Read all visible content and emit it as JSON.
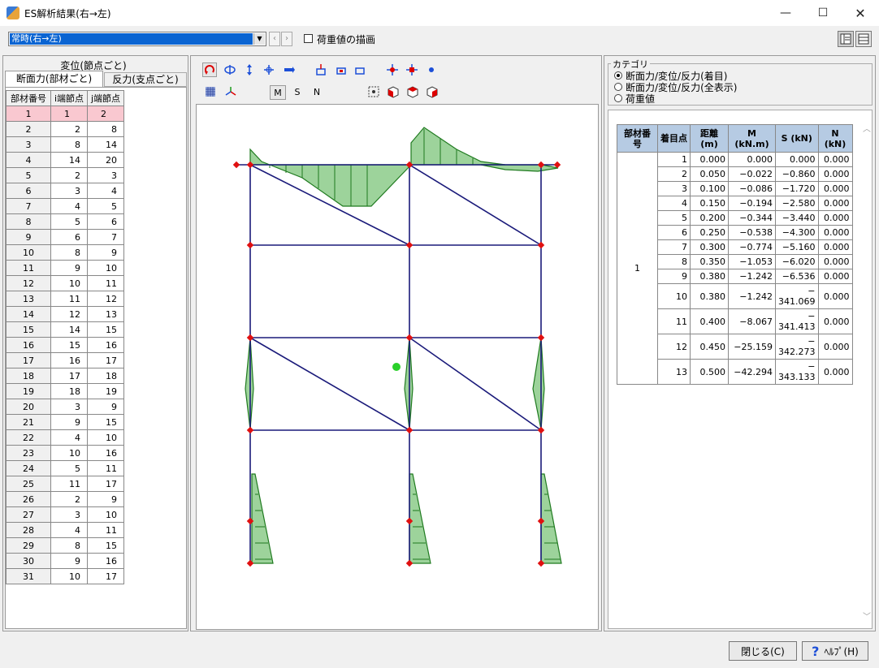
{
  "window": {
    "title": "ES解析結果(右→左)",
    "controls": {
      "minimize": "—",
      "maximize": "☐",
      "close": "✕"
    }
  },
  "toolbar": {
    "case_value": "常時(右→左)",
    "prev": "‹",
    "next": "›",
    "load_checkbox_label": "荷重値の描画",
    "load_checkbox_checked": false
  },
  "left": {
    "tab_top": "変位(節点ごと)",
    "tab_forces": "断面力(部材ごと)",
    "tab_reactions": "反力(支点ごと)",
    "table": {
      "headers": [
        "部材番号",
        "i端節点",
        "j端節点"
      ],
      "selected_index": 0,
      "rows": [
        [
          "1",
          "1",
          "2"
        ],
        [
          "2",
          "2",
          "8"
        ],
        [
          "3",
          "8",
          "14"
        ],
        [
          "4",
          "14",
          "20"
        ],
        [
          "5",
          "2",
          "3"
        ],
        [
          "6",
          "3",
          "4"
        ],
        [
          "7",
          "4",
          "5"
        ],
        [
          "8",
          "5",
          "6"
        ],
        [
          "9",
          "6",
          "7"
        ],
        [
          "10",
          "8",
          "9"
        ],
        [
          "11",
          "9",
          "10"
        ],
        [
          "12",
          "10",
          "11"
        ],
        [
          "13",
          "11",
          "12"
        ],
        [
          "14",
          "12",
          "13"
        ],
        [
          "15",
          "14",
          "15"
        ],
        [
          "16",
          "15",
          "16"
        ],
        [
          "17",
          "16",
          "17"
        ],
        [
          "18",
          "17",
          "18"
        ],
        [
          "19",
          "18",
          "19"
        ],
        [
          "20",
          "3",
          "9"
        ],
        [
          "21",
          "9",
          "15"
        ],
        [
          "22",
          "4",
          "10"
        ],
        [
          "23",
          "10",
          "16"
        ],
        [
          "24",
          "5",
          "11"
        ],
        [
          "25",
          "11",
          "17"
        ],
        [
          "26",
          "2",
          "9"
        ],
        [
          "27",
          "3",
          "10"
        ],
        [
          "28",
          "4",
          "11"
        ],
        [
          "29",
          "8",
          "15"
        ],
        [
          "30",
          "9",
          "16"
        ],
        [
          "31",
          "10",
          "17"
        ]
      ]
    }
  },
  "center": {
    "mode_m": "M",
    "mode_s": "S",
    "mode_n": "N"
  },
  "right": {
    "category_title": "カテゴリ",
    "options": [
      {
        "label": "断面力/変位/反力(着目)",
        "checked": true
      },
      {
        "label": "断面力/変位/反力(全表示)",
        "checked": false
      },
      {
        "label": "荷重値",
        "checked": false
      }
    ],
    "results": {
      "headers": [
        "部材番号",
        "着目点",
        "距離\n(m)",
        "M\n(kN.m)",
        "S (kN)",
        "N\n(kN)"
      ],
      "member": "1",
      "rows": [
        [
          "1",
          "0.000",
          "0.000",
          "0.000",
          "0.000"
        ],
        [
          "2",
          "0.050",
          "−0.022",
          "−0.860",
          "0.000"
        ],
        [
          "3",
          "0.100",
          "−0.086",
          "−1.720",
          "0.000"
        ],
        [
          "4",
          "0.150",
          "−0.194",
          "−2.580",
          "0.000"
        ],
        [
          "5",
          "0.200",
          "−0.344",
          "−3.440",
          "0.000"
        ],
        [
          "6",
          "0.250",
          "−0.538",
          "−4.300",
          "0.000"
        ],
        [
          "7",
          "0.300",
          "−0.774",
          "−5.160",
          "0.000"
        ],
        [
          "8",
          "0.350",
          "−1.053",
          "−6.020",
          "0.000"
        ],
        [
          "9",
          "0.380",
          "−1.242",
          "−6.536",
          "0.000"
        ],
        [
          "10",
          "0.380",
          "−1.242",
          "−\n341.069",
          "0.000"
        ],
        [
          "11",
          "0.400",
          "−8.067",
          "−\n341.413",
          "0.000"
        ],
        [
          "12",
          "0.450",
          "−25.159",
          "−\n342.273",
          "0.000"
        ],
        [
          "13",
          "0.500",
          "−42.294",
          "−\n343.133",
          "0.000"
        ]
      ]
    }
  },
  "buttons": {
    "close": "閉じる(C)",
    "help": "ﾍﾙﾌﾟ(H)"
  },
  "colors": {
    "accent": "#0a64d2",
    "selected_row": "#f9c8d0",
    "header_blue": "#b6cbe3",
    "frame_line": "#1a1a7a",
    "diagram_fill": "#7cc47a",
    "diagram_stroke": "#1f7a1f",
    "node": "#e01010"
  }
}
